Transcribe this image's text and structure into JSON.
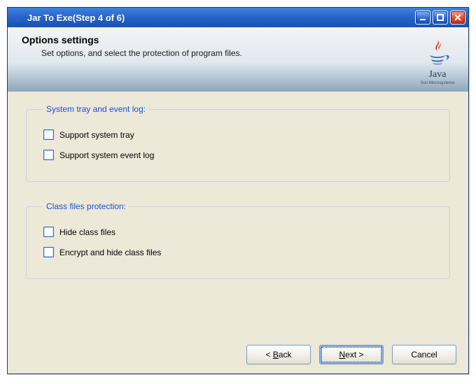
{
  "window": {
    "title": "Jar To Exe(Step 4 of 6)"
  },
  "header": {
    "title": "Options settings",
    "subtitle": "Set options, and select the protection of program files.",
    "logo_text": "Java"
  },
  "groups": {
    "tray": {
      "legend": "System tray and event log:",
      "items": [
        {
          "label": "Support system tray",
          "checked": false
        },
        {
          "label": "Support system event log",
          "checked": false
        }
      ]
    },
    "protect": {
      "legend": "Class files protection:",
      "items": [
        {
          "label": "Hide class files",
          "checked": false
        },
        {
          "label": "Encrypt and hide class files",
          "checked": false
        }
      ]
    }
  },
  "buttons": {
    "back_prefix": "< ",
    "back_u": "B",
    "back_rest": "ack",
    "next_u": "N",
    "next_rest": "ext >",
    "cancel": "Cancel"
  }
}
